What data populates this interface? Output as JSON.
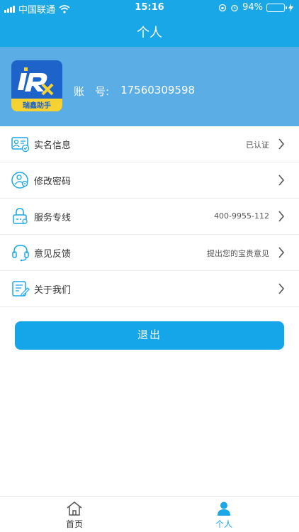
{
  "status_bar": {
    "carrier": "中国联通",
    "time": "15:16",
    "battery_percent": "94%",
    "battery_level": 0.94
  },
  "nav": {
    "title": "个人"
  },
  "profile": {
    "logo_text": "瑞鑫助手",
    "account_label": "账　号:",
    "account_value": "17560309598"
  },
  "menu": [
    {
      "label": "实名信息",
      "value": "已认证",
      "icon": "id-card-icon"
    },
    {
      "label": "修改密码",
      "value": "",
      "icon": "user-key-icon"
    },
    {
      "label": "服务专线",
      "value": "400-9955-112",
      "icon": "phone-lock-icon"
    },
    {
      "label": "意见反馈",
      "value": "提出您的宝贵意见",
      "icon": "headset-icon"
    },
    {
      "label": "关于我们",
      "value": "",
      "icon": "document-edit-icon"
    }
  ],
  "logout_label": "退出",
  "tabs": [
    {
      "label": "首页",
      "icon": "home-icon",
      "active": false
    },
    {
      "label": "个人",
      "icon": "person-icon",
      "active": true
    }
  ],
  "colors": {
    "primary": "#1aa7e8",
    "header": "#5aaee5",
    "accent_yellow": "#f6d233"
  }
}
